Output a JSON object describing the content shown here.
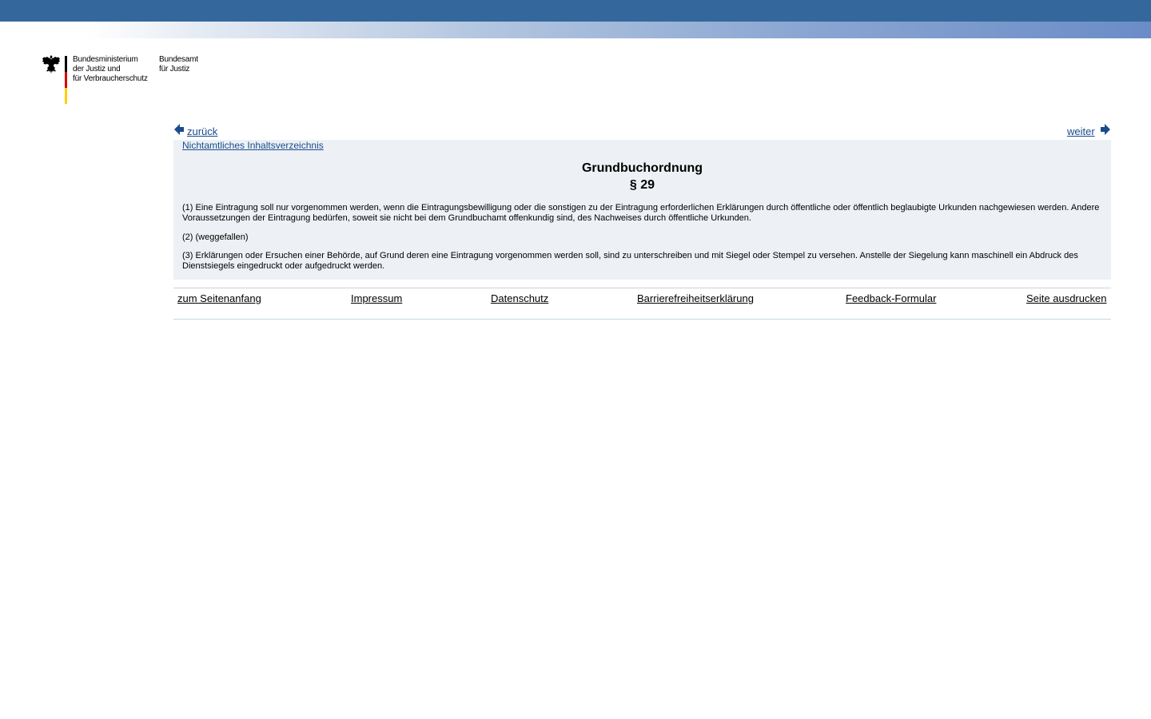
{
  "header": {
    "ministry_lines": [
      "Bundesministerium",
      "der Justiz und",
      "für Verbraucherschutz"
    ],
    "amt_lines": [
      "Bundesamt",
      "für Justiz"
    ]
  },
  "nav": {
    "back_label": "zurück",
    "next_label": "weiter"
  },
  "content": {
    "toc_label": "Nichtamtliches Inhaltsverzeichnis",
    "law_title": "Grundbuchordnung",
    "section_title": "§ 29",
    "paragraphs": [
      "(1) Eine Eintragung soll nur vorgenommen werden, wenn die Eintragungsbewilligung oder die sonstigen zu der Eintragung erforderlichen Erklärungen durch öffentliche oder öffentlich beglaubigte Urkunden nachgewiesen werden. Andere Voraussetzungen der Eintragung bedürfen, soweit sie nicht bei dem Grundbuchamt offenkundig sind, des Nachweises durch öffentliche Urkunden.",
      "(2) (weggefallen)",
      "(3) Erklärungen oder Ersuchen einer Behörde, auf Grund deren eine Eintragung vorgenommen werden soll, sind zu unterschreiben und mit Siegel oder Stempel zu versehen. Anstelle der Siegelung kann maschinell ein Abdruck des Dienstsiegels eingedruckt oder aufgedruckt werden."
    ]
  },
  "footer": {
    "links": [
      "zum Seitenanfang",
      "Impressum",
      "Datenschutz",
      "Barrierefreiheitserklärung",
      "Feedback-Formular",
      "Seite ausdrucken"
    ]
  },
  "colors": {
    "top_bar": "#34689c",
    "link": "#1a4c8c",
    "content_bg": "#edf1f5",
    "footer_border": "#c7d6df"
  }
}
